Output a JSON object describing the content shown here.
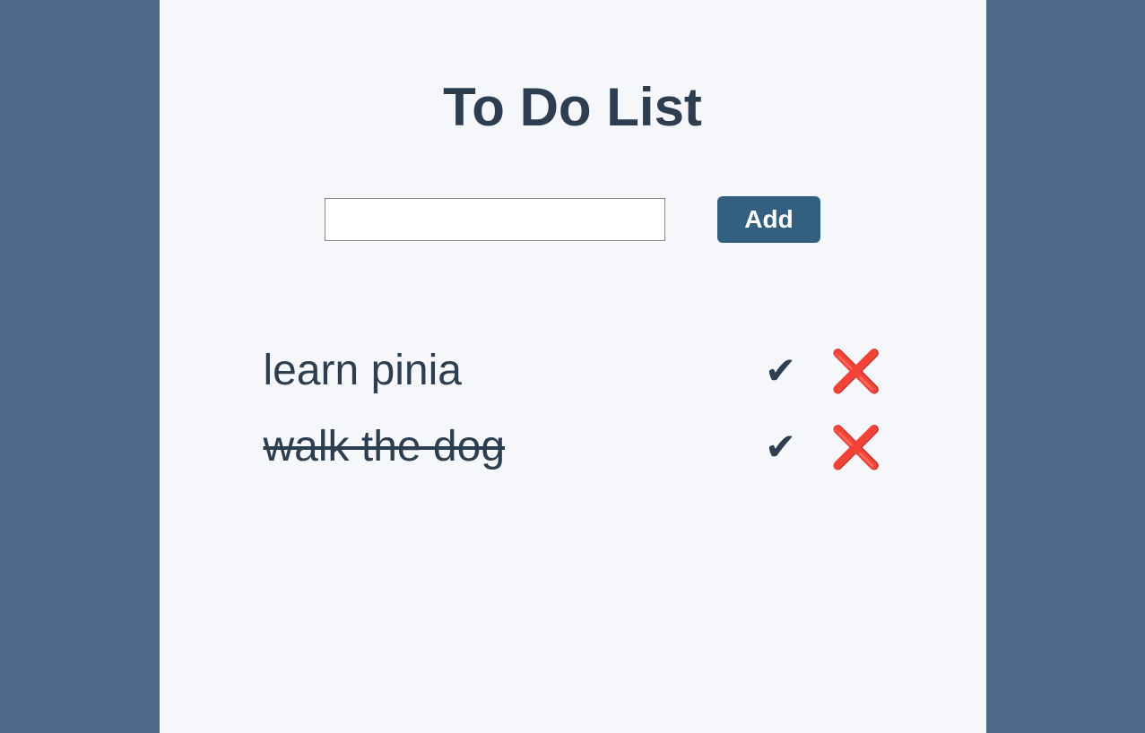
{
  "title": "To Do List",
  "form": {
    "input_value": "",
    "add_label": "Add"
  },
  "icons": {
    "check": "✔",
    "cross": "❌"
  },
  "items": [
    {
      "text": "learn pinia",
      "completed": false
    },
    {
      "text": "walk the dog",
      "completed": true
    }
  ]
}
